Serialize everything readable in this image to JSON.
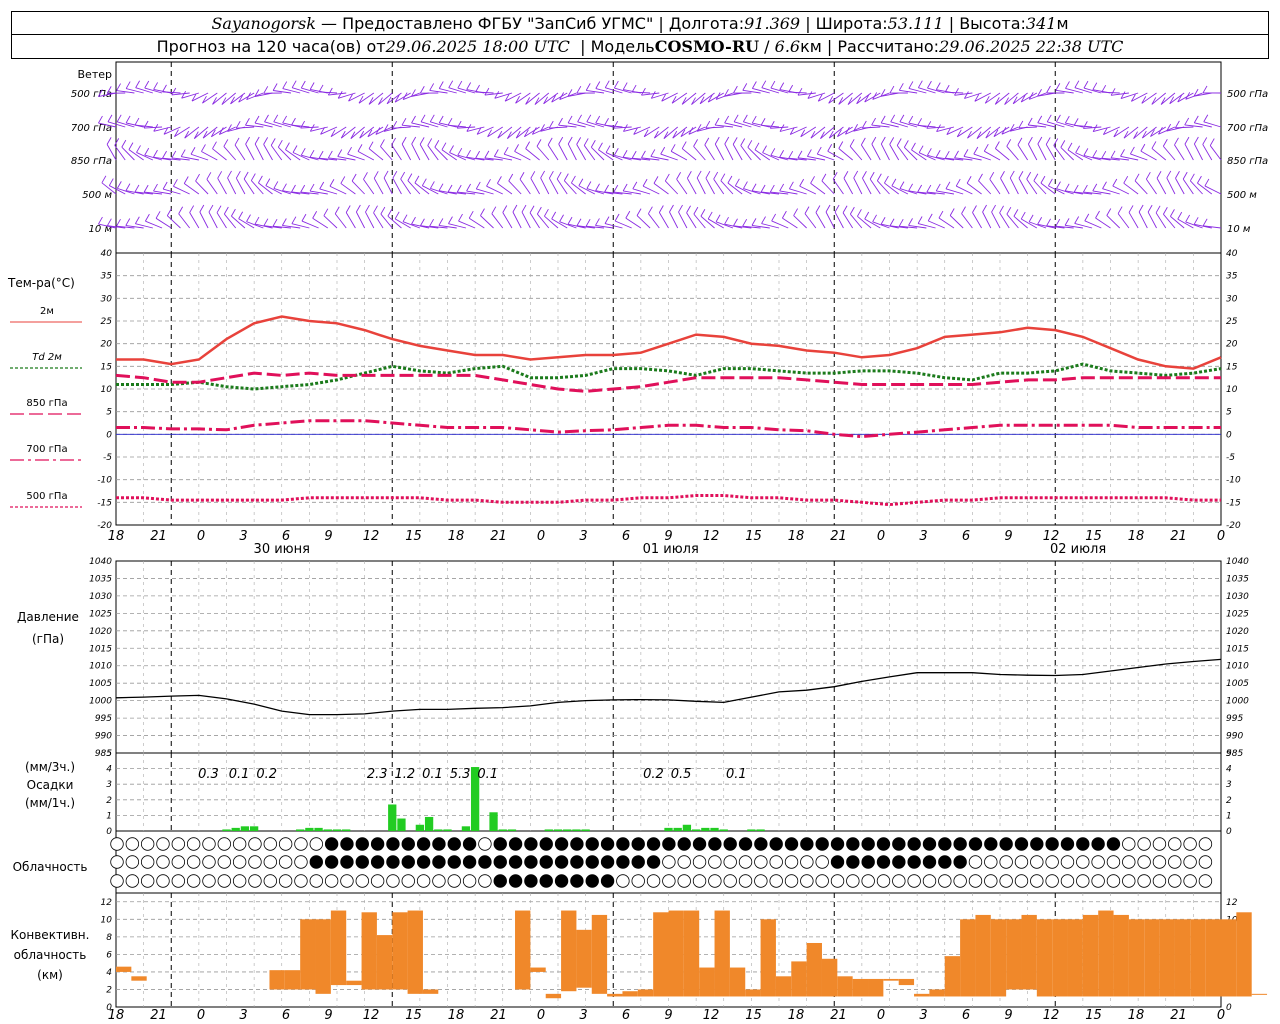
{
  "header": {
    "station": "Sayanogorsk",
    "provider": "Предоставлено ФГБУ \"ЗапСиб УГМС\"",
    "lon_label": "Долгота:",
    "lon": "91.369",
    "lat_label": "Широта:",
    "lat": "53.111",
    "alt_label": "Высота:",
    "alt": "341",
    "alt_unit": "м",
    "forecast_prefix": "Прогноз на 120 часа(ов) от",
    "forecast_time": "29.06.2025 18:00 UTC",
    "model_label": "Модель",
    "model": "COSMO-RU",
    "model_res": "6.6",
    "model_res_unit": "км",
    "calc_label": "Рассчитано:",
    "calc_time": "29.06.2025 22:38 UTC"
  },
  "labels": {
    "wind": "Ветер",
    "levels": [
      "500 гПа",
      "700 гПа",
      "850 гПа",
      "500 м",
      "10  м"
    ],
    "temp": "Тем-ра(°C)",
    "legend": [
      {
        "label": "2м",
        "color": "#e8423b",
        "style": "solid"
      },
      {
        "label": "Td  2м",
        "color": "#1b7a1b",
        "style": "dotted"
      },
      {
        "label": "850 гПа",
        "color": "#e0105a",
        "style": "dashed"
      },
      {
        "label": "700 гПа",
        "color": "#e0105a",
        "style": "dashdot"
      },
      {
        "label": "500 гПа",
        "color": "#e0105a",
        "style": "dotted"
      }
    ],
    "pressure": [
      "Давление",
      "(гПа)"
    ],
    "precip": [
      "(мм/3ч.)",
      "Осадки",
      "(мм/1ч.)"
    ],
    "cloud": "Облачность",
    "conv": [
      "Конвективн.",
      "облачность",
      "(км)"
    ]
  },
  "x_ticks": [
    "18",
    "21",
    "0",
    "3",
    "6",
    "9",
    "12",
    "15",
    "18",
    "21",
    "0",
    "3",
    "6",
    "9",
    "12",
    "15",
    "18",
    "21",
    "0",
    "3",
    "6",
    "9",
    "12",
    "15",
    "18",
    "21",
    "0"
  ],
  "dates": [
    "30 июня",
    "01 июля",
    "02 июля"
  ],
  "colors": {
    "wind": "#8a2be2",
    "t2m": "#e8423b",
    "td": "#1b7a1b",
    "upper": "#e0105a",
    "precip": "#22cc22",
    "conv": "#f0882a"
  },
  "chart_data": [
    {
      "type": "line",
      "title": "Тем-ра(°C)",
      "x_hours_from_start": [
        0,
        3,
        6,
        9,
        12,
        15,
        18,
        21,
        24,
        27,
        30,
        33,
        36,
        39,
        42,
        45,
        48,
        51,
        54,
        57,
        60,
        63,
        66,
        69,
        72,
        75,
        78,
        81,
        84,
        87,
        90,
        93,
        96,
        99,
        102,
        105,
        108,
        111,
        114,
        117,
        120
      ],
      "series": [
        {
          "name": "2м",
          "values": [
            16.5,
            16.5,
            15.5,
            16.5,
            21,
            24.5,
            26,
            25,
            24.5,
            23,
            21,
            19.5,
            18.5,
            17.5,
            17.5,
            16.5,
            17,
            17.5,
            17.5,
            18,
            20,
            22,
            21.5,
            20,
            19.5,
            18.5,
            18,
            17,
            17.5,
            19,
            21.5,
            22,
            22.5,
            23.5,
            23,
            21.5,
            19,
            16.5,
            15,
            14.5,
            17
          ]
        },
        {
          "name": "Td  2м",
          "values": [
            11,
            11,
            11,
            11.5,
            10.5,
            10,
            10.5,
            11,
            12,
            13.5,
            15,
            14,
            13.5,
            14.5,
            15,
            12.5,
            12.5,
            13,
            14.5,
            14.5,
            14,
            13,
            14.5,
            14.5,
            14,
            13.5,
            13.5,
            14,
            14,
            13.5,
            12.5,
            12,
            13.5,
            13.5,
            14,
            15.5,
            14,
            13.5,
            13,
            13.5,
            14.5
          ]
        },
        {
          "name": "850 гПа",
          "values": [
            13,
            12.5,
            11.5,
            11.5,
            12.5,
            13.5,
            13,
            13.5,
            13,
            13,
            13,
            13,
            13,
            13,
            12,
            11,
            10,
            9.5,
            10,
            10.5,
            11.5,
            12.5,
            12.5,
            12.5,
            12.5,
            12,
            11.5,
            11,
            11,
            11,
            11,
            11,
            11.5,
            12,
            12,
            12.5,
            12.5,
            12.5,
            12.5,
            12.5,
            12.5
          ]
        },
        {
          "name": "700 гПа",
          "values": [
            1.5,
            1.5,
            1.2,
            1.2,
            1,
            2,
            2.5,
            3,
            3,
            3,
            2.5,
            2,
            1.5,
            1.5,
            1.5,
            1,
            0.5,
            0.8,
            1,
            1.5,
            2,
            2,
            1.5,
            1.5,
            1,
            0.8,
            0,
            -0.5,
            0,
            0.5,
            1,
            1.5,
            2,
            2,
            2,
            2,
            2,
            1.5,
            1.5,
            1.5,
            1.5
          ]
        },
        {
          "name": "500 гПа",
          "values": [
            -14,
            -14,
            -14.5,
            -14.5,
            -14.5,
            -14.5,
            -14.5,
            -14,
            -14,
            -14,
            -14,
            -14,
            -14.5,
            -14.5,
            -15,
            -15,
            -15,
            -14.5,
            -14.5,
            -14,
            -14,
            -13.5,
            -13.5,
            -14,
            -14,
            -14.5,
            -14.5,
            -15,
            -15.5,
            -15,
            -14.5,
            -14.5,
            -14,
            -14,
            -14,
            -14,
            -14,
            -14,
            -14,
            -14.5,
            -14.5
          ]
        }
      ],
      "xlabel": "",
      "ylabel": "",
      "ylim": [
        -20,
        40
      ],
      "grid": true
    },
    {
      "type": "line",
      "title": "Давление (гПа)",
      "x_hours_from_start": [
        0,
        3,
        6,
        9,
        12,
        15,
        18,
        21,
        24,
        27,
        30,
        33,
        36,
        39,
        42,
        45,
        48,
        51,
        54,
        57,
        60,
        63,
        66,
        69,
        72,
        75,
        78,
        81,
        84,
        87,
        90,
        93,
        96,
        99,
        102,
        105,
        108,
        111,
        114,
        117,
        120
      ],
      "series": [
        {
          "name": "Давление",
          "values": [
            1000.8,
            1001,
            1001.3,
            1001.5,
            1000.5,
            999,
            997,
            996,
            996,
            996.2,
            997,
            997.5,
            997.5,
            997.8,
            998,
            998.5,
            999.5,
            1000,
            1000.2,
            1000.3,
            1000.2,
            999.8,
            999.5,
            1001,
            1002.5,
            1003,
            1004,
            1005.5,
            1006.8,
            1008,
            1008,
            1008,
            1007.5,
            1007.3,
            1007.2,
            1007.5,
            1008.5,
            1009.5,
            1010.5,
            1011.2,
            1011.8
          ]
        }
      ],
      "ylim": [
        985,
        1040
      ],
      "grid": true
    },
    {
      "type": "bar",
      "title": "Осадки",
      "series": [
        {
          "name": "(мм/1ч.)",
          "x_hours_from_start": [
            12,
            13,
            14,
            15,
            20,
            21,
            22,
            23,
            24,
            25,
            30,
            31,
            33,
            34,
            35,
            36,
            38,
            39,
            41,
            42,
            43,
            47,
            48,
            49,
            50,
            51,
            60,
            61,
            62,
            63,
            64,
            65,
            66,
            69,
            70
          ],
          "values": [
            0.1,
            0.2,
            0.3,
            0.3,
            0.1,
            0.2,
            0.2,
            0.1,
            0.1,
            0.1,
            1.7,
            0.8,
            0.4,
            0.9,
            0.1,
            0.1,
            0.3,
            4.1,
            1.2,
            0.1,
            0.1,
            0.1,
            0.1,
            0.1,
            0.1,
            0.1,
            0.2,
            0.2,
            0.4,
            0.1,
            0.2,
            0.2,
            0.1,
            0.1,
            0.1
          ]
        },
        {
          "name": "(мм/3ч.)",
          "x_hours_from_start": [
            12,
            15,
            18,
            30,
            33,
            36,
            39,
            42
          ],
          "values": [
            0.3,
            0.1,
            0.2,
            2.3,
            1.2,
            0.1,
            5.3,
            0.1
          ]
        },
        {
          "name": "(мм/3ч.) 02 июля",
          "x_hours_from_start": [
            60,
            63,
            69
          ],
          "values": [
            0.2,
            0.5,
            0.1
          ]
        }
      ],
      "ylim": [
        0,
        5
      ]
    },
    {
      "type": "bar",
      "title": "Конвективн. облачность (км)",
      "series": [
        {
          "name": "Конвективн. облачность",
          "x_hours_from_start": [
            0,
            1,
            10,
            11,
            12,
            13,
            14,
            15,
            16,
            17,
            18,
            19,
            20,
            26,
            27,
            28,
            29,
            30,
            31,
            32,
            33,
            34,
            35,
            36,
            37,
            38,
            39,
            40,
            41,
            42,
            43,
            44,
            45,
            46,
            47,
            48,
            49,
            50,
            51,
            52,
            53,
            54,
            55,
            56,
            57,
            58,
            59,
            60,
            61,
            62,
            63,
            64,
            65,
            66,
            67,
            68,
            69,
            70,
            71,
            72,
            73,
            74
          ],
          "bottoms": [
            4,
            3,
            2,
            2,
            2,
            1.5,
            2.5,
            2.5,
            2,
            2,
            2,
            1.5,
            1.5,
            2,
            4,
            1,
            1.8,
            2.2,
            1.5,
            1.2,
            1.2,
            1.2,
            1.2,
            1.2,
            1.2,
            1.2,
            1.2,
            1.2,
            1.2,
            1.2,
            1.2,
            1.2,
            1.2,
            1.2,
            1.2,
            1.2,
            1.2,
            3,
            2.5,
            1.2,
            1.2,
            1.2,
            1.2,
            1.2,
            1.2,
            2,
            2,
            1.2,
            1.2,
            1.2,
            1.2,
            1.2,
            1.2,
            1.2,
            1.2,
            1.2,
            1.2,
            1.2,
            1.2,
            1.2,
            1.2,
            1.5
          ],
          "tops": [
            4.6,
            3.5,
            4.2,
            4.2,
            10,
            10,
            11,
            3,
            10.8,
            8.2,
            10.8,
            11,
            2,
            11,
            4.5,
            1.5,
            11,
            8.8,
            10.5,
            1.5,
            1.8,
            2,
            10.8,
            11,
            11,
            4.5,
            11,
            4.5,
            2,
            10,
            3.5,
            5.2,
            7.3,
            5.5,
            3.5,
            3.2,
            3.2,
            3.2,
            3.2,
            1.5,
            2,
            5.8,
            10,
            10.5,
            10,
            10,
            10.5,
            10,
            10,
            10,
            10.5,
            11,
            10.5,
            10,
            10,
            10,
            10,
            10,
            10,
            10,
            10.8,
            1.5
          ]
        }
      ],
      "ylim": [
        0,
        13
      ]
    }
  ]
}
